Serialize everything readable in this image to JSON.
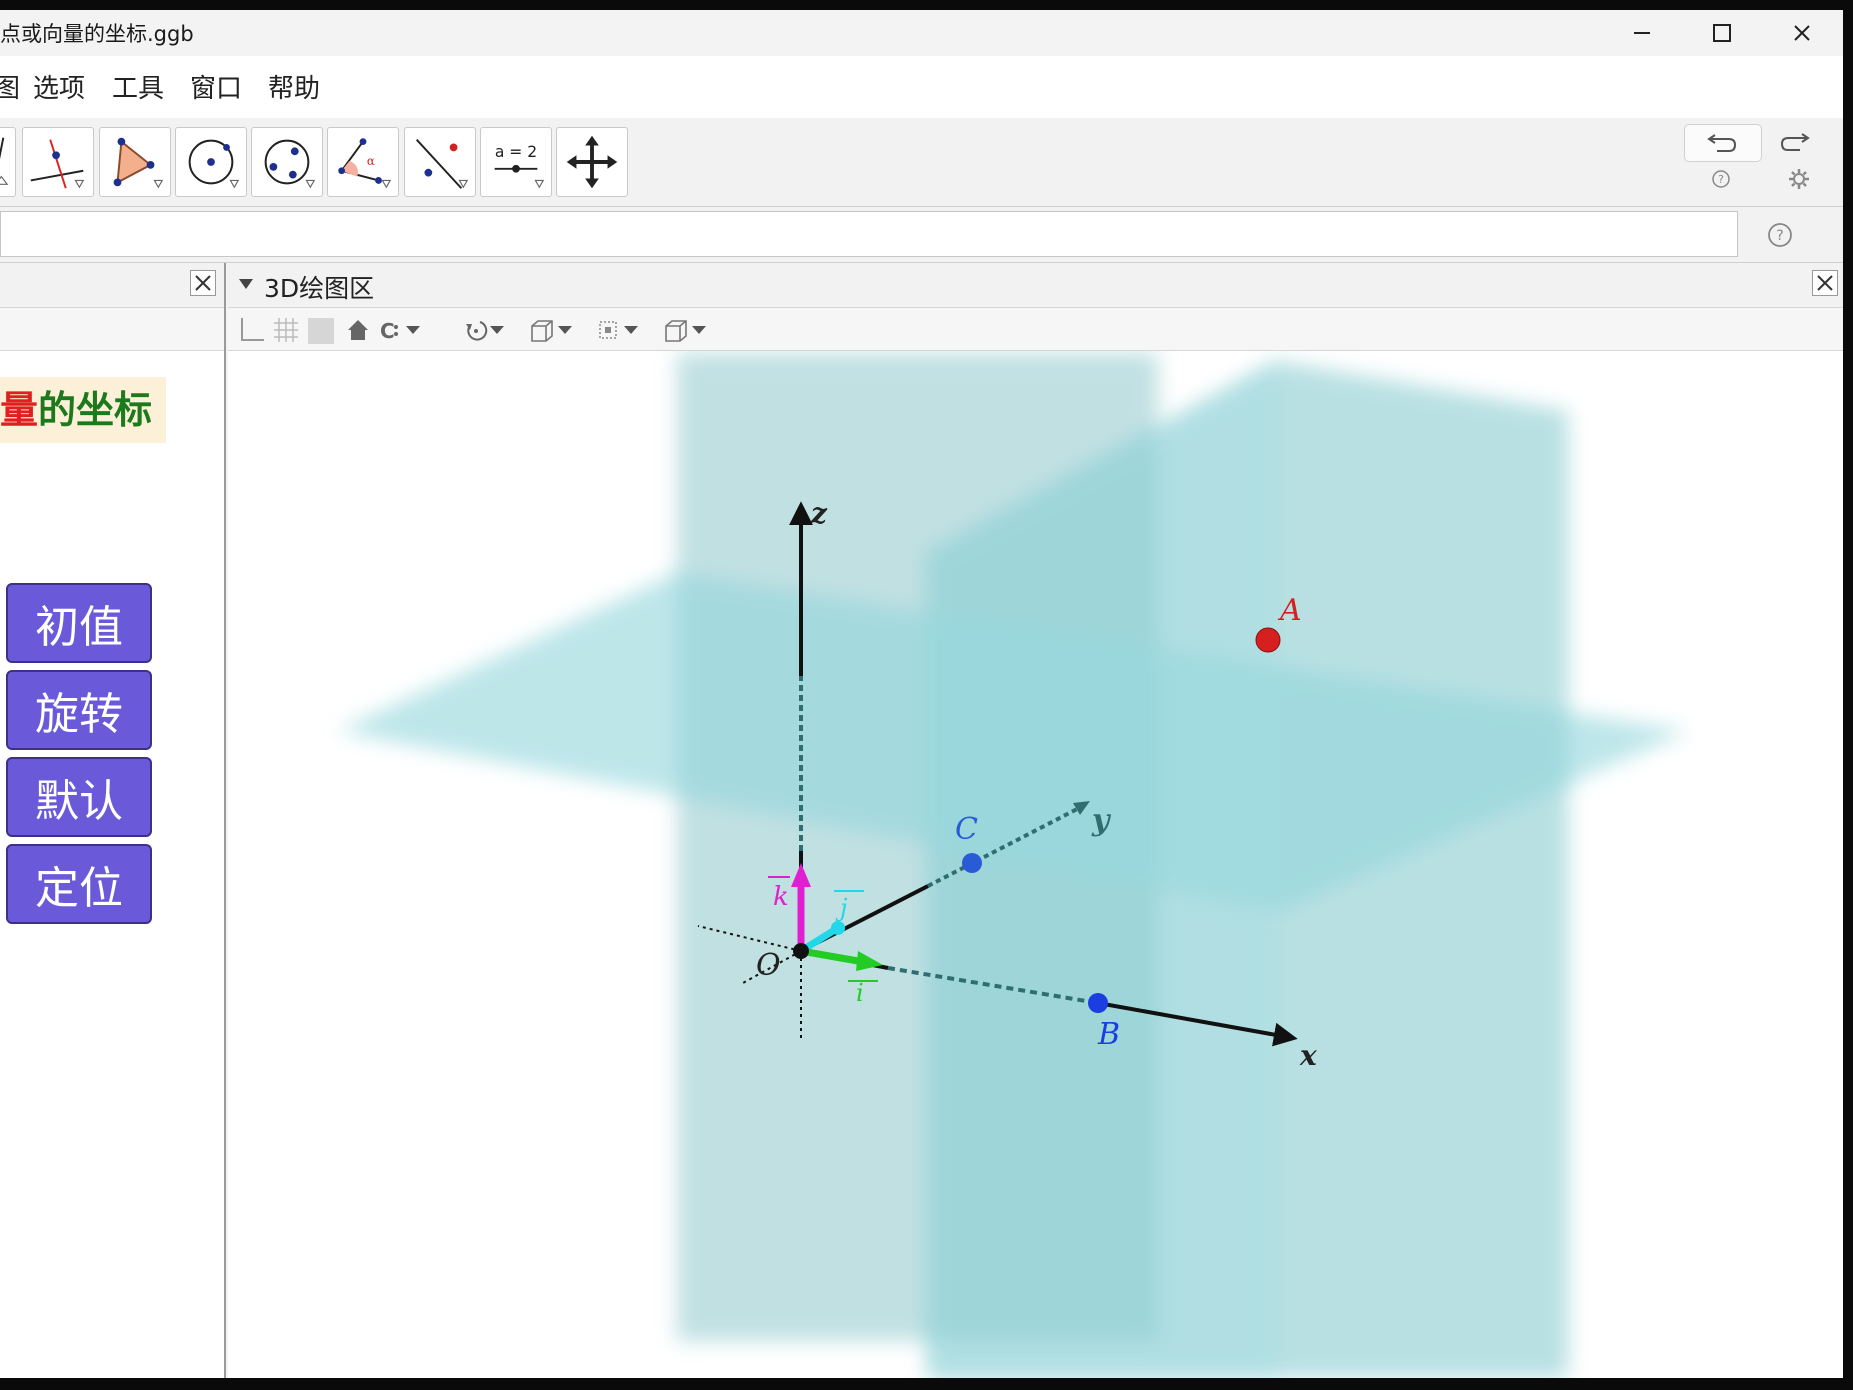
{
  "window": {
    "title": "点或向量的坐标.ggb"
  },
  "menu": [
    "图",
    "选项",
    "工具",
    "窗口",
    "帮助"
  ],
  "toolbar": {
    "slider_tool_label": "a = 2"
  },
  "input": {
    "value": ""
  },
  "left_panel": {
    "title_part1": "量",
    "title_part2": "的坐标",
    "buttons": [
      "初值",
      "旋转",
      "默认",
      "定位"
    ]
  },
  "view3d": {
    "title": "3D绘图区",
    "labels": {
      "z_axis": "z",
      "y_axis": "y",
      "x_axis": "x",
      "origin": "O",
      "point_a": "A",
      "point_b": "B",
      "point_c": "C",
      "vec_k": "k",
      "vec_j": "j",
      "vec_i": "i"
    },
    "colors": {
      "plane": "#8fd3d9",
      "point_a": "#d62020",
      "point_b": "#1a3ee0",
      "point_c": "#2a5bd7",
      "vec_k": "#e020d0",
      "vec_j": "#20d8e8",
      "vec_i": "#22cc22",
      "button": "#6a5ad9"
    }
  }
}
